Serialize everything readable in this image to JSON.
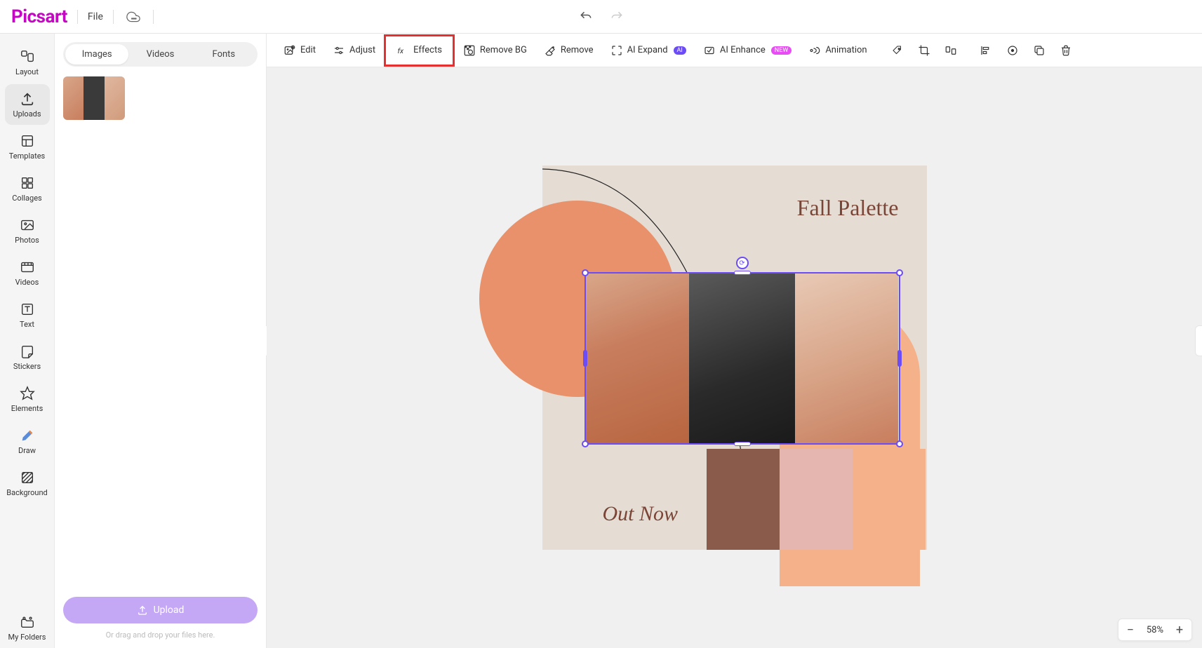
{
  "header": {
    "logo": "Picsart",
    "file_label": "File"
  },
  "sidebar": {
    "items": [
      {
        "label": "Layout",
        "icon": "layout"
      },
      {
        "label": "Uploads",
        "icon": "upload"
      },
      {
        "label": "Templates",
        "icon": "templates"
      },
      {
        "label": "Collages",
        "icon": "collages"
      },
      {
        "label": "Photos",
        "icon": "photos"
      },
      {
        "label": "Videos",
        "icon": "videos"
      },
      {
        "label": "Text",
        "icon": "text"
      },
      {
        "label": "Stickers",
        "icon": "stickers"
      },
      {
        "label": "Elements",
        "icon": "elements"
      },
      {
        "label": "Draw",
        "icon": "draw"
      },
      {
        "label": "Background",
        "icon": "background"
      },
      {
        "label": "My Folders",
        "icon": "folders"
      }
    ],
    "active_index": 1
  },
  "panel": {
    "tabs": [
      "Images",
      "Videos",
      "Fonts"
    ],
    "active_tab": 0,
    "upload_label": "Upload",
    "drop_hint": "Or drag and drop your files here."
  },
  "toolbar": {
    "edit": "Edit",
    "adjust": "Adjust",
    "effects": "Effects",
    "remove_bg": "Remove BG",
    "remove": "Remove",
    "ai_expand": "AI Expand",
    "ai_enhance": "AI Enhance",
    "animation": "Animation",
    "badge_ai": "AI",
    "badge_new": "NEW"
  },
  "canvas": {
    "title": "Fall Palette",
    "subtitle": "Out Now",
    "swatches": [
      "#8a5a4a",
      "#e5b5b0",
      "#f5b28a"
    ]
  },
  "zoom": {
    "value": "58%"
  }
}
